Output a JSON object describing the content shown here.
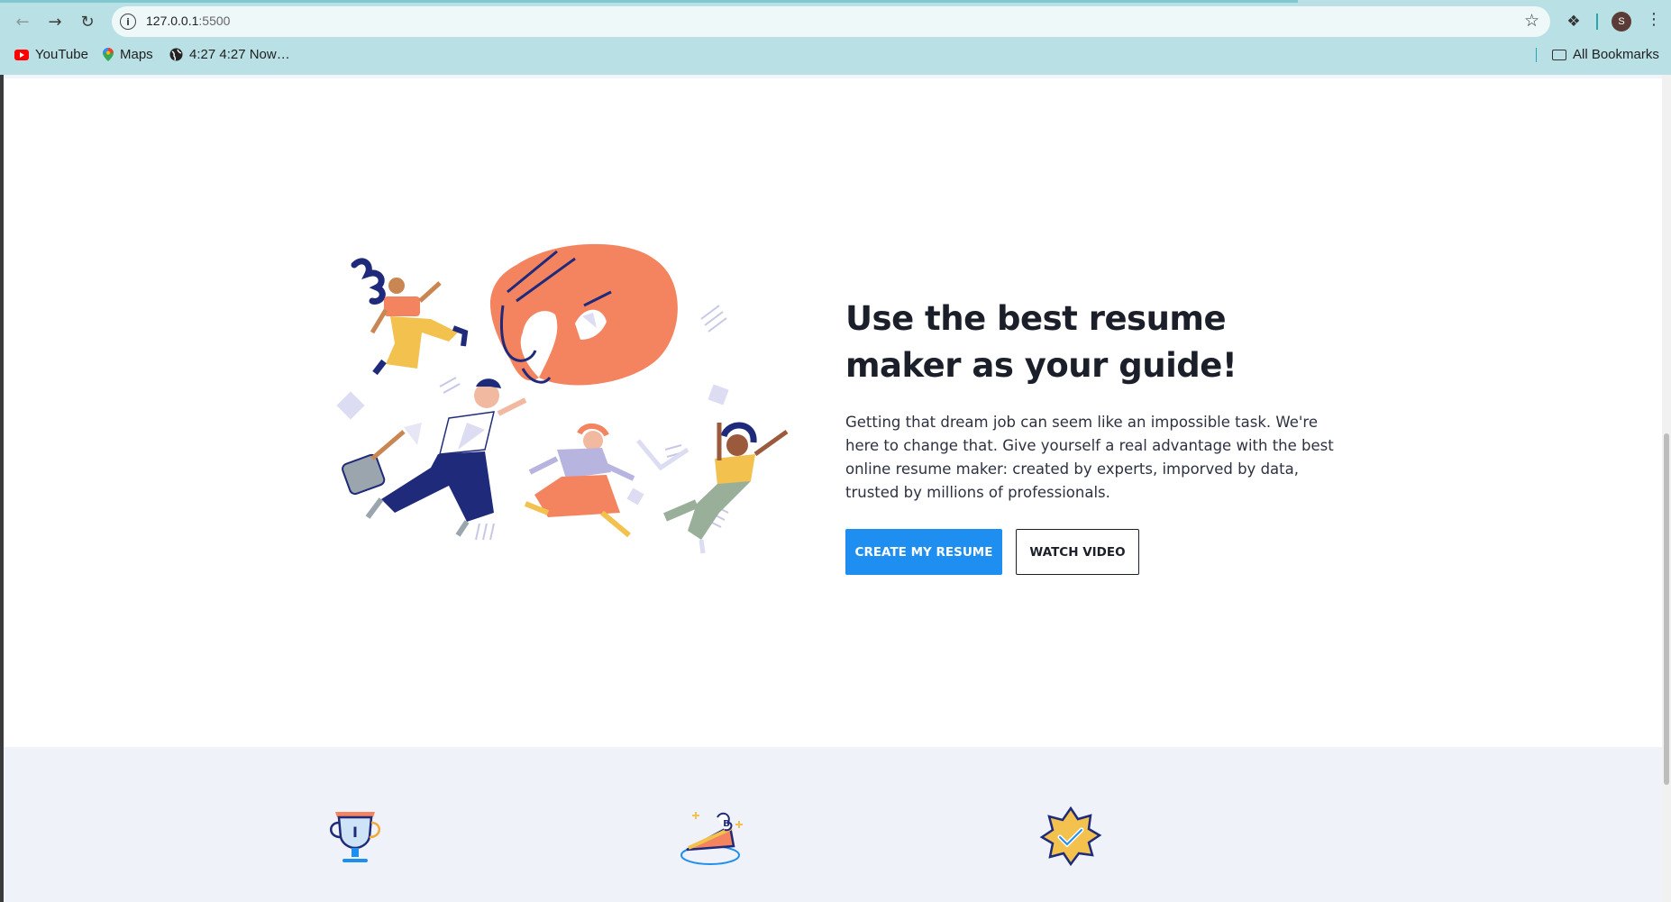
{
  "browser": {
    "url_host": "127.0.0.1",
    "url_port": ":5500",
    "avatar_letter": "S",
    "bookmarks": [
      {
        "label": "YouTube",
        "icon": "youtube-icon"
      },
      {
        "label": "Maps",
        "icon": "maps-pin-icon"
      },
      {
        "label": "4:27 4:27 Now…",
        "icon": "globe-icon"
      }
    ],
    "all_bookmarks_label": "All Bookmarks"
  },
  "hero": {
    "title": "Use the best resume maker as your guide!",
    "description": "Getting that dream job can seem like an impossible task. We're here to change that. Give yourself a real advantage with the best online resume maker: created by experts, imporved by data, trusted by millions of professionals.",
    "primary_button": "CREATE MY RESUME",
    "secondary_button": "WATCH VIDEO"
  },
  "colors": {
    "accent": "#1e8ef0",
    "browser_chrome": "#b9e1e5",
    "features_bg": "#f0f2f9",
    "illustration_orange": "#f4845f",
    "illustration_navy": "#1f2a7a"
  },
  "features": [
    {
      "icon": "trophy-icon"
    },
    {
      "icon": "cake-slice-icon"
    },
    {
      "icon": "badge-check-icon"
    }
  ]
}
